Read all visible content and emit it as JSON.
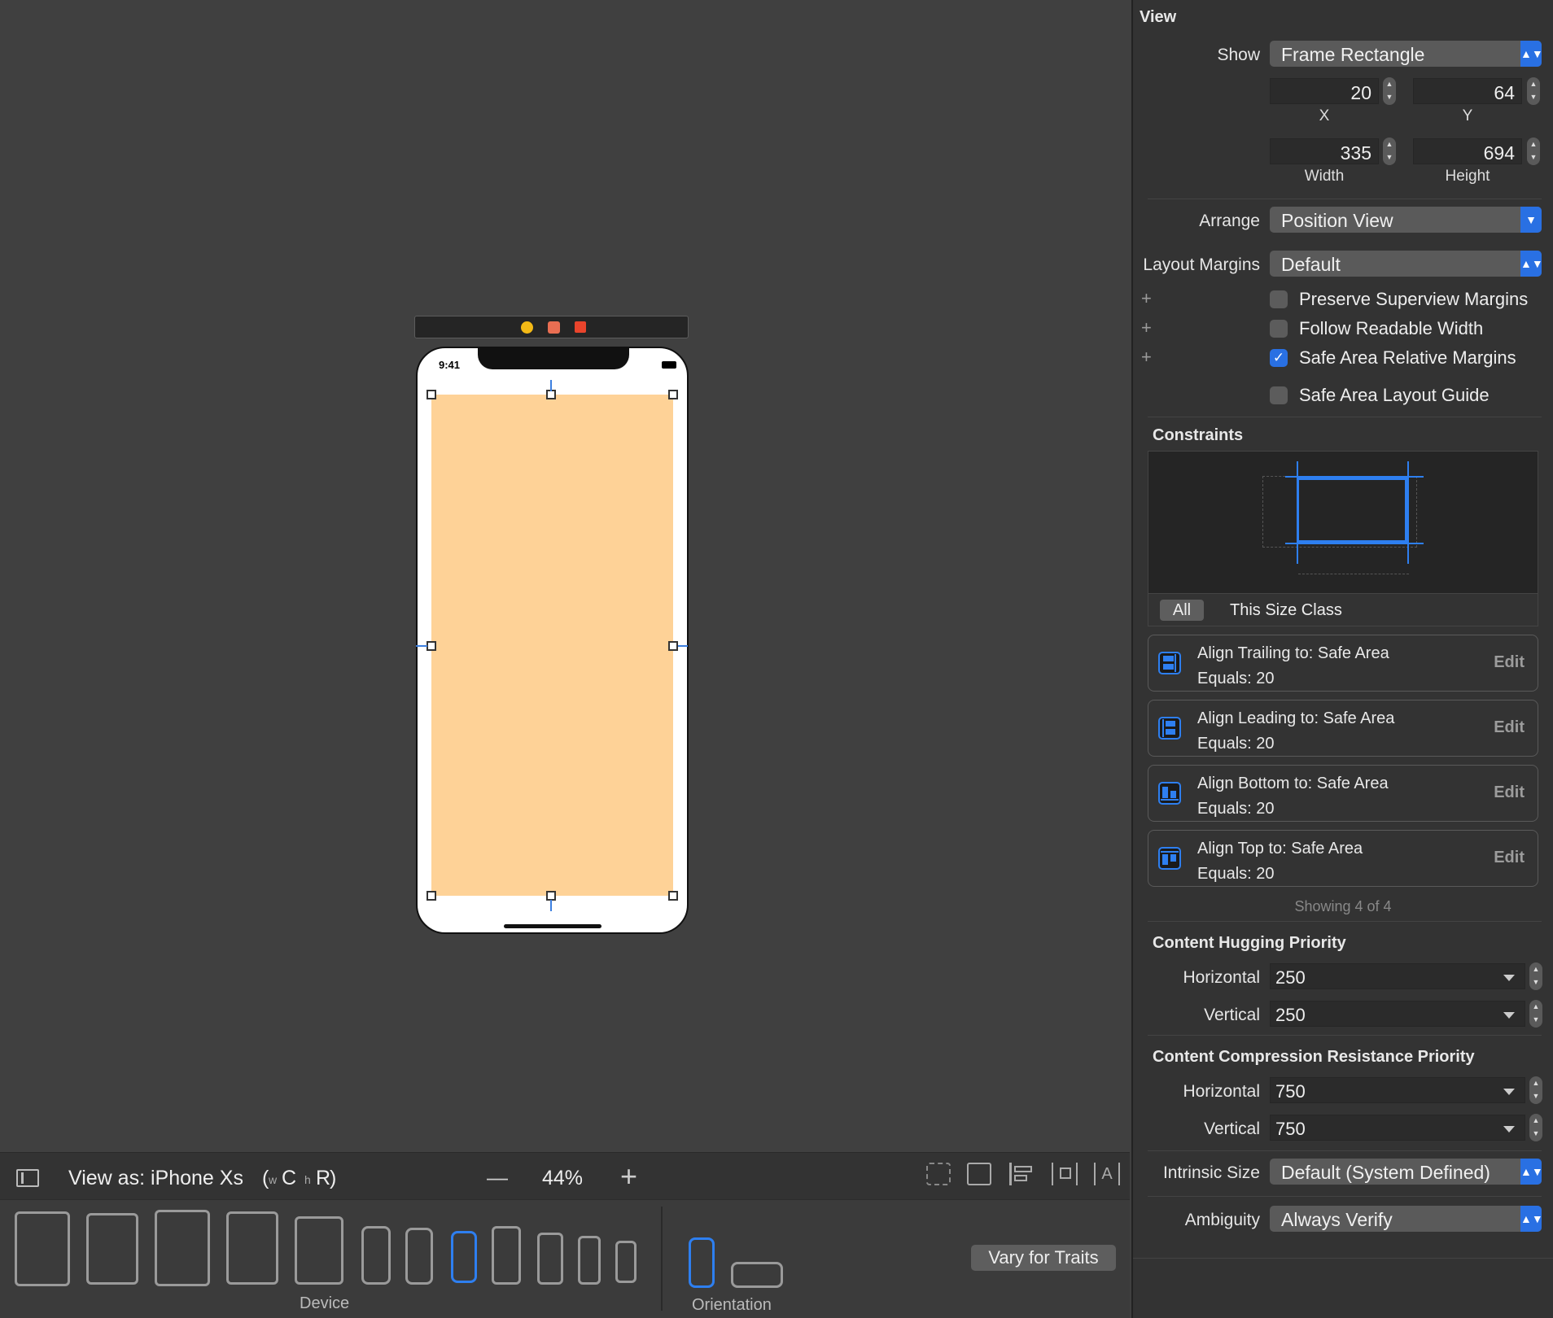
{
  "phone": {
    "time": "9:41"
  },
  "view_bar": {
    "view_as_label": "View as: iPhone Xs",
    "size_w": "w",
    "size_w_class": "C",
    "size_h": "h",
    "size_h_class": "R",
    "close_paren": ")",
    "paren_open": "(",
    "zoom_minus": "—",
    "zoom": "44%",
    "zoom_plus": "+"
  },
  "device_bar": {
    "device_label": "Device",
    "orientation_label": "Orientation",
    "vary_button": "Vary for Traits"
  },
  "inspector": {
    "view_title": "View",
    "show_label": "Show",
    "show_value": "Frame Rectangle",
    "x": "20",
    "x_label": "X",
    "y": "64",
    "y_label": "Y",
    "width": "335",
    "width_label": "Width",
    "height": "694",
    "height_label": "Height",
    "arrange_label": "Arrange",
    "arrange_value": "Position View",
    "layout_margins_label": "Layout Margins",
    "layout_margins_value": "Default",
    "checkboxes": [
      {
        "label": "Preserve Superview Margins",
        "checked": false
      },
      {
        "label": "Follow Readable Width",
        "checked": false
      },
      {
        "label": "Safe Area Relative Margins",
        "checked": true
      },
      {
        "label": "Safe Area Layout Guide",
        "checked": false
      }
    ],
    "constraints_title": "Constraints",
    "seg_all": "All",
    "seg_size_class": "This Size Class",
    "constraints": [
      {
        "line1": "Align Trailing to:  Safe Area",
        "line2": "Equals:  20",
        "edit": "Edit"
      },
      {
        "line1": "Align Leading to:  Safe Area",
        "line2": "Equals:  20",
        "edit": "Edit"
      },
      {
        "line1": "Align Bottom to:  Safe Area",
        "line2": "Equals:  20",
        "edit": "Edit"
      },
      {
        "line1": "Align Top to:  Safe Area",
        "line2": "Equals:  20",
        "edit": "Edit"
      }
    ],
    "showing": "Showing 4 of 4",
    "hugging_title": "Content Hugging Priority",
    "hugging_h_label": "Horizontal",
    "hugging_h": "250",
    "hugging_v_label": "Vertical",
    "hugging_v": "250",
    "compression_title": "Content Compression Resistance Priority",
    "compression_h_label": "Horizontal",
    "compression_h": "750",
    "compression_v_label": "Vertical",
    "compression_v": "750",
    "intrinsic_label": "Intrinsic Size",
    "intrinsic_value": "Default (System Defined)",
    "ambiguity_label": "Ambiguity",
    "ambiguity_value": "Always Verify"
  },
  "colors": {
    "accent": "#2970e3",
    "view_fill": "#fed297",
    "background": "#404040"
  }
}
